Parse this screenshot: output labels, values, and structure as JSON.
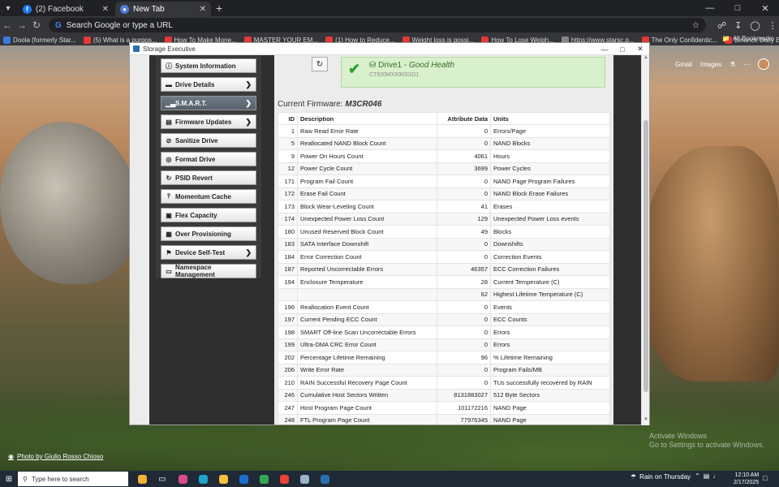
{
  "browser": {
    "tabs": [
      {
        "title": "(2) Facebook",
        "favicon": "facebook-icon",
        "active": false
      },
      {
        "title": "New Tab",
        "favicon": "globe-icon",
        "active": true
      }
    ],
    "omnibox_placeholder": "Search Google or type a URL",
    "bookmarks": [
      "Doola (formerly Star...",
      "(5) What is a purpos...",
      "How To Make Mone...",
      "MASTER YOUR EM...",
      "(1) How to Reduce...",
      "Weight loss is possi...",
      "How To Lose Weigh...",
      "https://www.starsc.p...",
      "The Only Confidentic...",
      "Binance Daily Earnin..."
    ],
    "all_bookmarks": "All Bookmarks"
  },
  "desktop": {
    "links": [
      "Gmail",
      "Images"
    ],
    "photo_credit": "Photo by Giulio Rosso Chioso",
    "watermark_line1": "Activate Windows",
    "watermark_line2": "Go to Settings to activate Windows."
  },
  "app": {
    "window_title": "Storage Executive",
    "sidebar": [
      {
        "label": "System Information",
        "icon": "info-icon",
        "chevron": false,
        "active": false
      },
      {
        "label": "Drive Details",
        "icon": "drive-icon",
        "chevron": true,
        "active": false
      },
      {
        "label": "S.M.A.R.T.",
        "icon": "chart-icon",
        "chevron": true,
        "active": true
      },
      {
        "label": "Firmware Updates",
        "icon": "firmware-icon",
        "chevron": true,
        "active": false
      },
      {
        "label": "Sanitize Drive",
        "icon": "sanitize-icon",
        "chevron": false,
        "active": false
      },
      {
        "label": "Format Drive",
        "icon": "format-icon",
        "chevron": false,
        "active": false
      },
      {
        "label": "PSID Revert",
        "icon": "psid-icon",
        "chevron": false,
        "active": false
      },
      {
        "label": "Momentum Cache",
        "icon": "cache-icon",
        "chevron": false,
        "active": false
      },
      {
        "label": "Flex Capacity",
        "icon": "flex-icon",
        "chevron": false,
        "active": false
      },
      {
        "label": "Over Provisioning",
        "icon": "grid-icon",
        "chevron": false,
        "active": false
      },
      {
        "label": "Device Self-Test",
        "icon": "flag-icon",
        "chevron": true,
        "active": false
      },
      {
        "label": "Namespace Management",
        "icon": "namespace-icon",
        "chevron": false,
        "active": false
      }
    ],
    "drive": {
      "name": "Drive1",
      "separator": " - ",
      "health": "Good Health",
      "model": "CT500MX500SSD1"
    },
    "firmware_label": "Current Firmware:",
    "firmware_value": "M3CR046",
    "table": {
      "headers": [
        "ID",
        "Description",
        "Attribute Data",
        "Units"
      ],
      "rows": [
        [
          "1",
          "Raw Read Error Rate",
          "0",
          "Errors/Page"
        ],
        [
          "5",
          "Reallocated NAND Block Count",
          "0",
          "NAND Blocks"
        ],
        [
          "9",
          "Power On Hours Count",
          "4061",
          "Hours"
        ],
        [
          "12",
          "Power Cycle Count",
          "3699",
          "Power Cycles"
        ],
        [
          "171",
          "Program Fail Count",
          "0",
          "NAND Page Program Failures"
        ],
        [
          "172",
          "Erase Fail Count",
          "0",
          "NAND Block Erase Failures"
        ],
        [
          "173",
          "Block Wear-Leveling Count",
          "41",
          "Erases"
        ],
        [
          "174",
          "Unexpected Power Loss Count",
          "129",
          "Unexpected Power Loss events"
        ],
        [
          "180",
          "Unused Reserved Block Count",
          "49",
          "Blocks"
        ],
        [
          "183",
          "SATA Interface Downshift",
          "0",
          "Downshifts"
        ],
        [
          "184",
          "Error Correction Count",
          "0",
          "Correction Events"
        ],
        [
          "187",
          "Reported Uncorrectable Errors",
          "46357",
          "ECC Correction Failures"
        ],
        [
          "194",
          "Enclosure Temperature",
          "28",
          "Current Temperature (C)"
        ],
        [
          "",
          "",
          "62",
          "Highest Lifetime Temperature (C)"
        ],
        [
          "196",
          "Reallocation Event Count",
          "0",
          "Events"
        ],
        [
          "197",
          "Current Pending ECC Count",
          "0",
          "ECC Counts"
        ],
        [
          "198",
          "SMART Off-line Scan Uncorrectable Errors",
          "0",
          "Errors"
        ],
        [
          "199",
          "Ultra-DMA CRC Error Count",
          "0",
          "Errors"
        ],
        [
          "202",
          "Percentage Lifetime Remaining",
          "96",
          "% Lifetime Remaining"
        ],
        [
          "206",
          "Write Error Rate",
          "0",
          "Program Fails/MB"
        ],
        [
          "210",
          "RAIN Successful Recovery Page Count",
          "0",
          "TUs successfully recovered by RAIN"
        ],
        [
          "246",
          "Cumulative Host Sectors Written",
          "8131883027",
          "512 Byte Sectors"
        ],
        [
          "247",
          "Host Program Page Count",
          "101172216",
          "NAND Page"
        ],
        [
          "248",
          "FTL Program Page Count",
          "77976345",
          "NAND Page"
        ]
      ]
    }
  },
  "taskbar": {
    "search_placeholder": "Type here to search",
    "weather": "Rain on Thursday",
    "time": "12:10 AM",
    "date": "2/17/2025"
  }
}
